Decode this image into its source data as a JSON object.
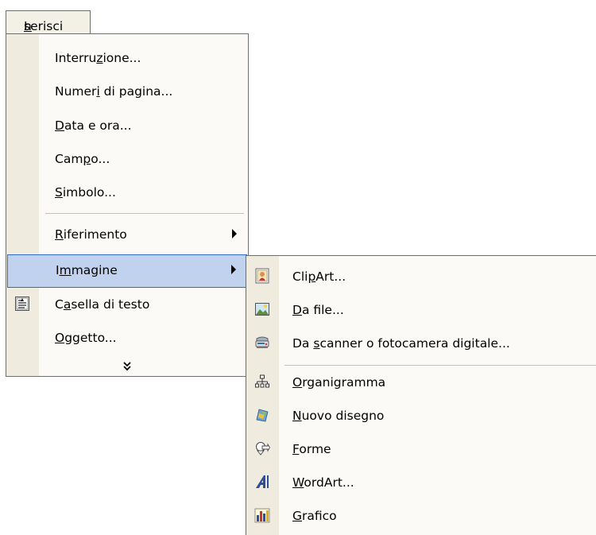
{
  "menu_title": {
    "pre": "I",
    "ul": "n",
    "post": "serisci"
  },
  "menu_items": [
    {
      "pre": "Interru",
      "ul": "z",
      "post": "ione..."
    },
    {
      "pre": "Numer",
      "ul": "i",
      "post": " di pagina..."
    },
    {
      "pre": "",
      "ul": "D",
      "post": "ata e ora..."
    },
    {
      "pre": "Cam",
      "ul": "p",
      "post": "o..."
    },
    {
      "pre": "",
      "ul": "S",
      "post": "imbolo..."
    },
    {
      "pre": "",
      "ul": "R",
      "post": "iferimento"
    },
    {
      "pre": "I",
      "ul": "m",
      "post": "magine"
    },
    {
      "pre": "C",
      "ul": "a",
      "post": "sella di testo"
    },
    {
      "pre": "",
      "ul": "O",
      "post": "ggetto..."
    }
  ],
  "expand_glyph": "»",
  "submenu_items": [
    {
      "pre": "Cli",
      "ul": "p",
      "post": "Art...",
      "icon": "clipart-icon"
    },
    {
      "pre": "",
      "ul": "D",
      "post": "a file...",
      "icon": "picture-file-icon"
    },
    {
      "pre": "Da ",
      "ul": "s",
      "post": "canner o fotocamera digitale...",
      "icon": "scanner-camera-icon"
    },
    {
      "pre": "",
      "ul": "O",
      "post": "rganigramma",
      "icon": "org-chart-icon"
    },
    {
      "pre": "",
      "ul": "N",
      "post": "uovo disegno",
      "icon": "new-drawing-icon"
    },
    {
      "pre": "",
      "ul": "F",
      "post": "orme",
      "icon": "autoshapes-icon"
    },
    {
      "pre": "",
      "ul": "W",
      "post": "ordArt...",
      "icon": "wordart-icon"
    },
    {
      "pre": "",
      "ul": "G",
      "post": "rafico",
      "icon": "chart-icon"
    }
  ],
  "colors": {
    "highlight_bg": "#c1d2ee",
    "highlight_border": "#316ac5",
    "gutter": "#efecdf",
    "menu_bg": "#fbfaf6"
  }
}
